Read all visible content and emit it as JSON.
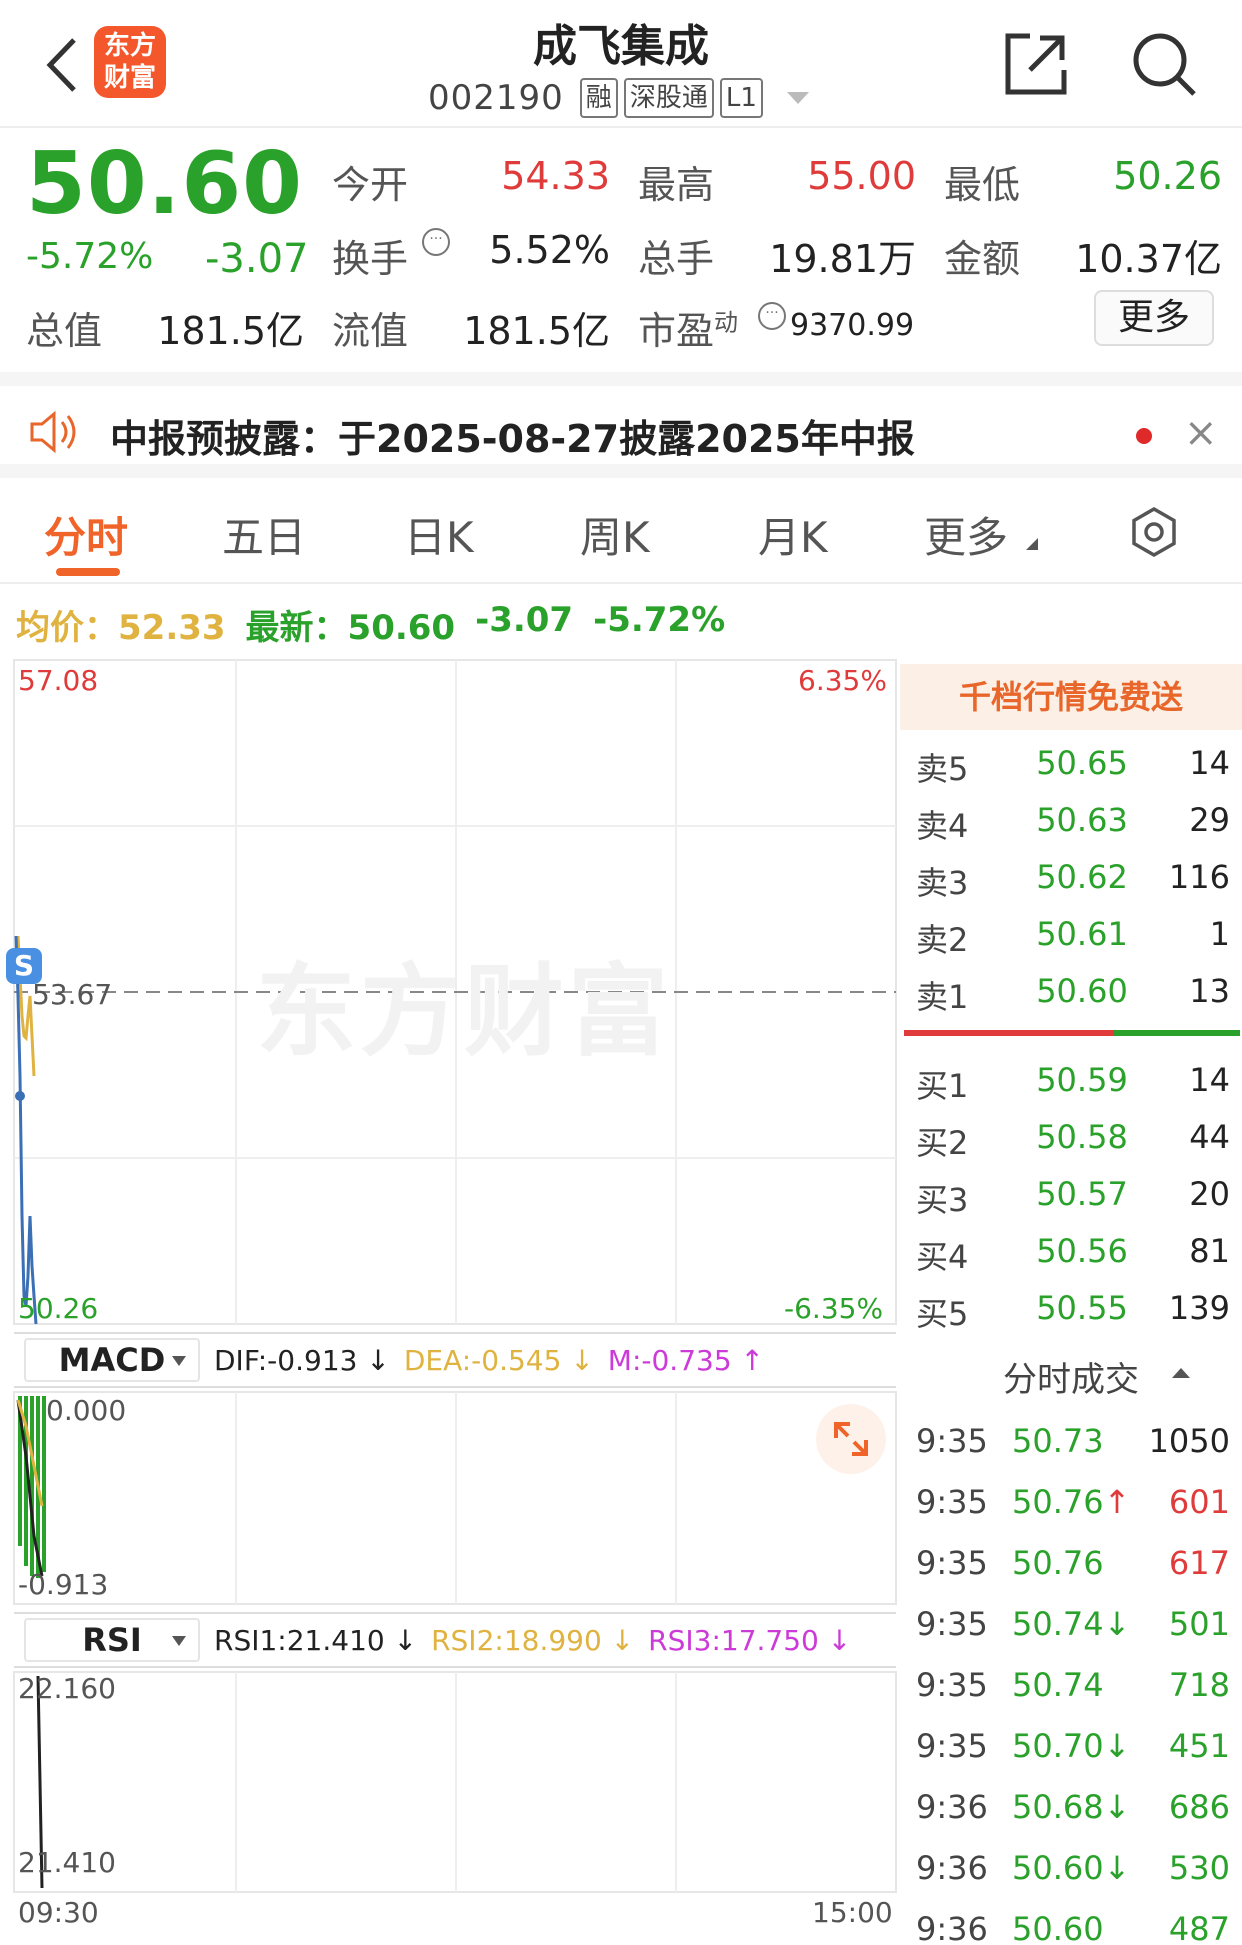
{
  "header": {
    "logo_text": "东方财富",
    "title": "成飞集成",
    "code": "002190",
    "tags": [
      "融",
      "深股通",
      "L1"
    ]
  },
  "quote": {
    "price": "50.60",
    "change_pct": "-5.72%",
    "change_val": "-3.07",
    "open_label": "今开",
    "open": "54.33",
    "high_label": "最高",
    "high": "55.00",
    "low_label": "最低",
    "low": "50.26",
    "turnover_label": "换手",
    "turnover": "5.52%",
    "volume_label": "总手",
    "volume": "19.81万",
    "amount_label": "金额",
    "amount": "10.37亿",
    "mktcap_label": "总值",
    "mktcap": "181.5亿",
    "float_label": "流值",
    "float_cap": "181.5亿",
    "pe_label": "市盈",
    "pe_sup": "动",
    "pe": "9370.99",
    "more_label": "更多"
  },
  "notice": {
    "text": "中报预披露：于2025-08-27披露2025年中报",
    "close": "×"
  },
  "tabs": [
    "分时",
    "五日",
    "日K",
    "周K",
    "月K",
    "更多"
  ],
  "avg_row": {
    "avg_label": "均价：",
    "avg": "52.33",
    "last_label": "最新：",
    "last": "50.60",
    "chg": "-3.07",
    "pct": "-5.72%"
  },
  "chart": {
    "y_max": "57.08",
    "y_mid": "53.67",
    "y_min": "50.26",
    "pct_max": "6.35%",
    "pct_min": "-6.35%",
    "time_start": "09:30",
    "time_end": "15:00",
    "watermark": "东方财富",
    "badge": "S"
  },
  "macd": {
    "name": "MACD",
    "dif": "DIF:-0.913 ↓",
    "dea": "DEA:-0.545 ↓",
    "m": "M:-0.735 ↑",
    "axis_top": "0.000",
    "axis_bottom": "-0.913"
  },
  "rsi": {
    "name": "RSI",
    "rsi1": "RSI1:21.410 ↓",
    "rsi2": "RSI2:18.990 ↓",
    "rsi3": "RSI3:17.750 ↓",
    "axis_top": "22.160",
    "axis_bottom": "21.410"
  },
  "orderbook": {
    "promo": "千档行情免费送",
    "asks": [
      {
        "side": "卖5",
        "price": "50.65",
        "vol": "14"
      },
      {
        "side": "卖4",
        "price": "50.63",
        "vol": "29"
      },
      {
        "side": "卖3",
        "price": "50.62",
        "vol": "116"
      },
      {
        "side": "卖2",
        "price": "50.61",
        "vol": "1"
      },
      {
        "side": "卖1",
        "price": "50.60",
        "vol": "13"
      }
    ],
    "bids": [
      {
        "side": "买1",
        "price": "50.59",
        "vol": "14"
      },
      {
        "side": "买2",
        "price": "50.58",
        "vol": "44"
      },
      {
        "side": "买3",
        "price": "50.57",
        "vol": "20"
      },
      {
        "side": "买4",
        "price": "50.56",
        "vol": "81"
      },
      {
        "side": "买5",
        "price": "50.55",
        "vol": "139"
      }
    ]
  },
  "trades": {
    "title": "分时成交",
    "rows": [
      {
        "time": "9:35",
        "price": "50.73",
        "vol": "1050",
        "dir": ""
      },
      {
        "time": "9:35",
        "price": "50.76↑",
        "vol": "601",
        "dir": "up"
      },
      {
        "time": "9:35",
        "price": "50.76",
        "vol": "617",
        "dir": "up"
      },
      {
        "time": "9:35",
        "price": "50.74↓",
        "vol": "501",
        "dir": "down"
      },
      {
        "time": "9:35",
        "price": "50.74",
        "vol": "718",
        "dir": "down"
      },
      {
        "time": "9:35",
        "price": "50.70↓",
        "vol": "451",
        "dir": "down"
      },
      {
        "time": "9:36",
        "price": "50.68↓",
        "vol": "686",
        "dir": "down"
      },
      {
        "time": "9:36",
        "price": "50.60↓",
        "vol": "530",
        "dir": "down"
      },
      {
        "time": "9:36",
        "price": "50.60",
        "vol": "487",
        "dir": "down"
      }
    ]
  },
  "colors": {
    "up": "#e03b3b",
    "down": "#2aa12a",
    "accent": "#f0642a",
    "avg": "#e0b341",
    "price_line": "#3b6fb6"
  }
}
